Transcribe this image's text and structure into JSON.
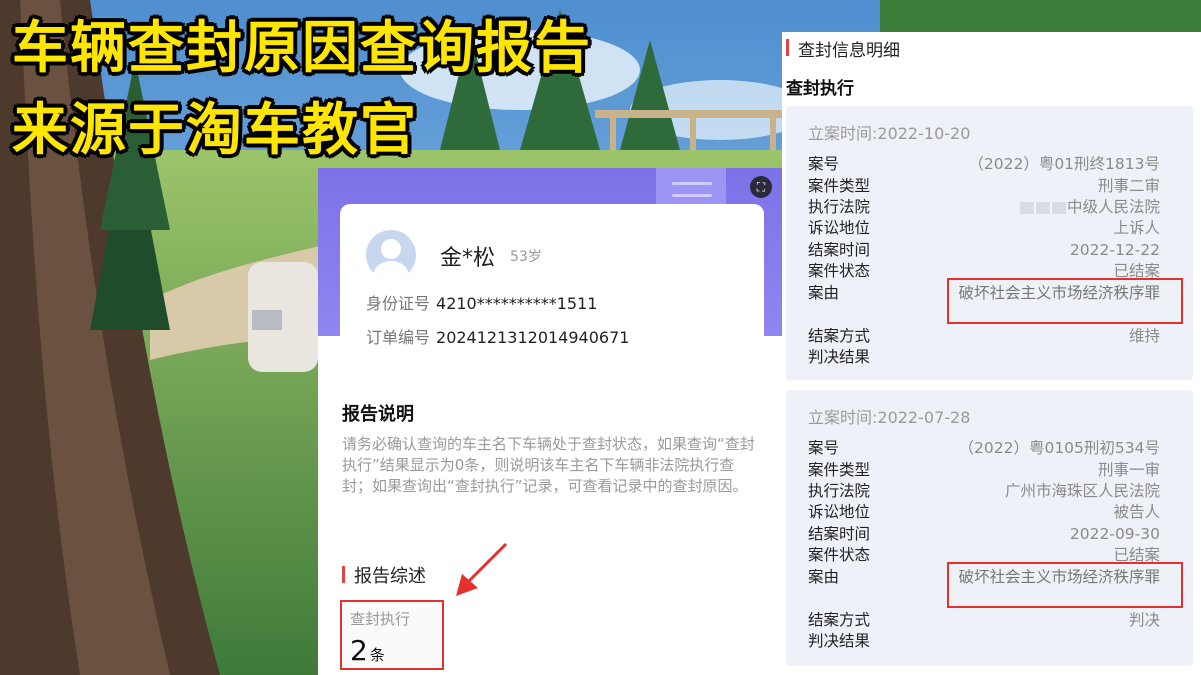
{
  "headline": {
    "line1": "车辆查封原因查询报告",
    "line2": "来源于淘车教官"
  },
  "profile": {
    "name": "金*松",
    "age": "53岁",
    "id_label": "身份证号",
    "id_value": "4210**********1511",
    "order_label": "订单编号",
    "order_value": "20241213120149406​71"
  },
  "report": {
    "title": "报告说明",
    "description": "请务必确认查询的车主名下车辆处于查封状态，如果查询“查封执行”结果显示为0条，则说明该车主名下车辆非法院执行查封；如果查询出“查封执行”记录，可查看记录中的查封原因。",
    "summary_title": "报告综述",
    "stat_label": "查封执行",
    "stat_value": "2",
    "stat_unit": "条"
  },
  "detail": {
    "title": "查封信息明细",
    "subtitle": "查封执行",
    "labels": {
      "case_no": "案号",
      "case_type": "案件类型",
      "court": "执行法院",
      "role": "诉讼地位",
      "closed_time": "结案时间",
      "status": "案件状态",
      "reason": "案由",
      "close_method": "结案方式",
      "verdict": "判决结果"
    },
    "records": [
      {
        "filed": "立案时间:2022-10-20",
        "case_no": "（2022）粤01刑终1813号",
        "case_type": "刑事二审",
        "court": "中级人民法院",
        "role": "上诉人",
        "closed_time": "2022-12-22",
        "status": "已结案",
        "reason": "破坏社会主义市场经济秩序罪",
        "close_method": "维持",
        "verdict": ""
      },
      {
        "filed": "立案时间:2022-07-28",
        "case_no": "（2022）粤0105刑初534号",
        "case_type": "刑事一审",
        "court": "广州市海珠区人民法院",
        "role": "被告人",
        "closed_time": "2022-09-30",
        "status": "已结案",
        "reason": "破坏社会主义市场经济秩序罪",
        "close_method": "判决",
        "verdict": ""
      }
    ]
  },
  "colors": {
    "headline": "#ffe600",
    "accent_red": "#e53030",
    "header_purple": "#7c72e8",
    "record_bg": "#eef2f8"
  }
}
